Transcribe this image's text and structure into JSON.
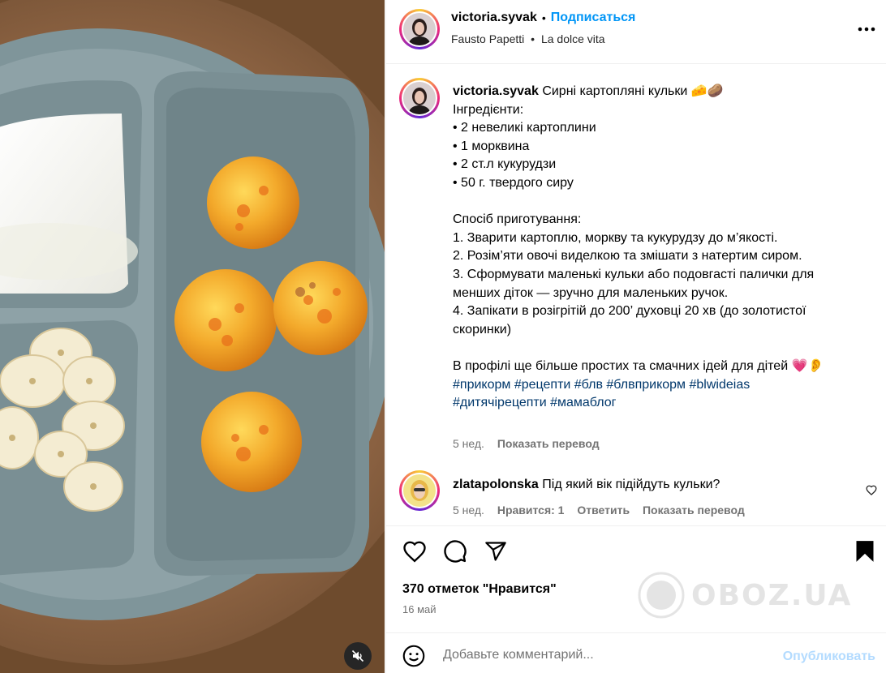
{
  "post": {
    "author": "victoria.syvak",
    "follow_label": "Подписаться",
    "separator": "•",
    "music": {
      "artist": "Fausto Papetti",
      "separator": "•",
      "track": "La dolce vita"
    },
    "caption": {
      "title": "Сирні картопляні кульки 🧀🥔",
      "body": "\nІнгредієнти:\n• 2 невеликі картоплини\n• 1 морквина\n• 2 ст.л кукурудзи\n• 50 г. твердого сиру\n\nСпосіб приготування:\n1. Зварити картоплю, моркву та кукурудзу до м’якості.\n2. Розім’яти овочі виделкою та змішати з натертим сиром.\n3. Сформувати маленькі кульки або подовгасті палички для менших діток — зручно для маленьких ручок.\n4. Запікати в розігрітій до 200’ духовці 20 хв (до золотистої скоринки)\n\nВ профілі ще більше простих та смачних ідей для дітей 💗👂",
      "hashtags_line1": "#прикорм #рецепти #блв #блвприкорм #blwideias",
      "hashtags_line2": "#дитячірецепти #мамаблог",
      "age": "5 нед.",
      "translate": "Показать перевод"
    },
    "comment": {
      "author": "zlatapolonska",
      "text": "Під який вік підійдуть кульки?",
      "age": "5 нед.",
      "likes": "Нравится: 1",
      "reply": "Ответить",
      "translate": "Показать перевод"
    },
    "likes_text": "370 отметок \"Нравится\"",
    "date": "16 май",
    "comment_placeholder": "Добавьте комментарий...",
    "publish_label": "Опубликовать"
  },
  "watermark": "OBOZ.UA",
  "icons": {
    "like": "heart-icon",
    "comment": "comment-icon",
    "share": "send-icon",
    "save": "bookmark-icon",
    "emoji": "smiley-icon",
    "more": "more-options-icon",
    "mute": "muted-speaker-icon",
    "comment_like": "heart-icon"
  },
  "colors": {
    "link_blue": "#0095f6",
    "hashtag": "#00376b",
    "muted_text": "#737373",
    "publish_disabled": "#b3dbff"
  }
}
